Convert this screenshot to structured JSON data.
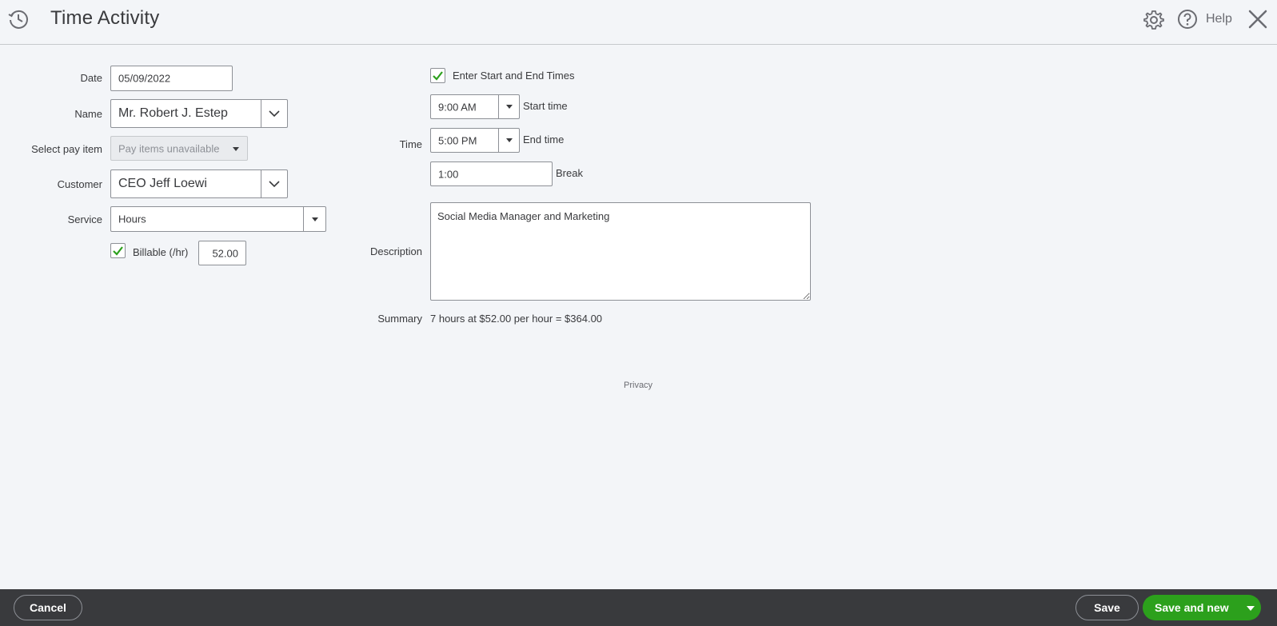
{
  "header": {
    "title": "Time Activity",
    "help_label": "Help",
    "icons": {
      "app": "clock-history-icon",
      "settings": "gear-icon",
      "help": "question-circle-icon",
      "close": "close-icon"
    }
  },
  "form": {
    "date": {
      "label": "Date",
      "value": "05/09/2022"
    },
    "name": {
      "label": "Name",
      "value": "Mr. Robert J. Estep"
    },
    "pay_item": {
      "label": "Select pay item",
      "value": "Pay items unavailable"
    },
    "customer": {
      "label": "Customer",
      "value": "CEO Jeff Loewi"
    },
    "service": {
      "label": "Service",
      "value": "Hours"
    },
    "billable": {
      "label": "Billable (/hr)",
      "checked": true,
      "rate": "52.00"
    },
    "enter_times": {
      "label": "Enter Start and End Times",
      "checked": true
    },
    "time": {
      "label": "Time",
      "start": {
        "value": "9:00 AM",
        "label": "Start time"
      },
      "end": {
        "value": "5:00 PM",
        "label": "End time"
      },
      "break": {
        "value": "1:00",
        "label": "Break"
      }
    },
    "description": {
      "label": "Description",
      "value": "Social Media Manager and Marketing"
    },
    "summary": {
      "label": "Summary",
      "value": "7 hours at $52.00 per hour = $364.00"
    }
  },
  "privacy_link": "Privacy",
  "footer": {
    "cancel": "Cancel",
    "save": "Save",
    "save_and_new": "Save and new"
  },
  "colors": {
    "accent_green": "#2ca01c",
    "footer_bg": "#393a3d",
    "page_bg": "#f3f5f8"
  }
}
